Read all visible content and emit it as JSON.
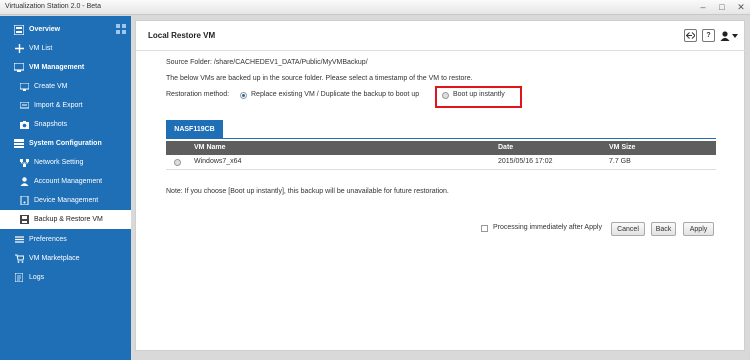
{
  "window": {
    "title": "Virtualization Station 2.0 - Beta",
    "controls": [
      "–",
      "□",
      "✕"
    ]
  },
  "sidebar": {
    "items": [
      {
        "label": "Overview",
        "icon": "overview-icon",
        "bold": true
      },
      {
        "label": "VM List",
        "icon": "plus-icon"
      },
      {
        "label": "VM Management",
        "icon": "vm-management-icon",
        "bold": true
      },
      {
        "label": "Create VM",
        "icon": "create-vm-icon"
      },
      {
        "label": "Import & Export",
        "icon": "import-export-icon"
      },
      {
        "label": "Snapshots",
        "icon": "snapshots-icon"
      },
      {
        "label": "System Configuration",
        "icon": "system-config-icon",
        "bold": true
      },
      {
        "label": "Network Setting",
        "icon": "network-icon"
      },
      {
        "label": "Account Management",
        "icon": "account-icon"
      },
      {
        "label": "Device Management",
        "icon": "device-icon"
      },
      {
        "label": "Backup & Restore VM",
        "icon": "backup-icon",
        "active": true
      },
      {
        "label": "Preferences",
        "icon": "preferences-icon"
      },
      {
        "label": "VM Marketplace",
        "icon": "marketplace-icon"
      },
      {
        "label": "Logs",
        "icon": "logs-icon"
      }
    ]
  },
  "panel": {
    "title": "Local Restore VM",
    "help_label": "?",
    "source_folder": "Source Folder: /share/CACHEDEV1_DATA/Public/MyVMBackup/",
    "description": "The below VMs are backed up in the source folder. Please select a timestamp of the VM to restore.",
    "restoration_label": "Restoration method:",
    "option_replace": "Replace existing VM / Duplicate the backup to boot up",
    "option_boot": "Boot up instantly",
    "source_tab": "NASF119CB",
    "table": {
      "headers": [
        "VM Name",
        "Date",
        "VM Size"
      ],
      "rows": [
        [
          "Windows7_x64",
          "2015/05/16 17:02",
          "7.7 GB"
        ]
      ]
    },
    "note": "Note: If you choose [Boot up instantly], this backup will be unavailable for future restoration.",
    "processing_label": "Processing immediately after Apply",
    "buttons": {
      "cancel": "Cancel",
      "back": "Back",
      "apply": "Apply"
    }
  },
  "colors": {
    "sidebar": "#1e6fb5",
    "highlight": "#e0151b",
    "table_header": "#5e5e5e"
  }
}
